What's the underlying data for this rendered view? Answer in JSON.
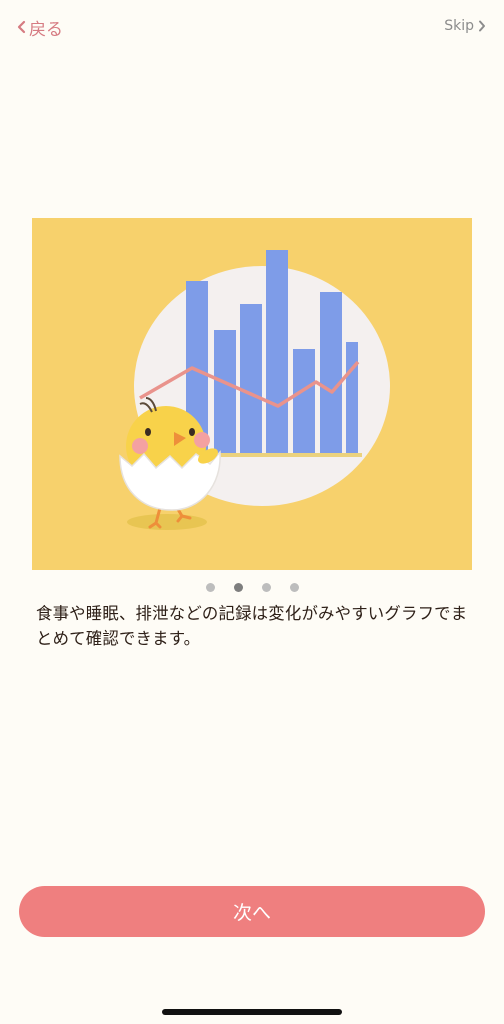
{
  "nav": {
    "back_label": "戻る",
    "skip_label": "Skip"
  },
  "carousel": {
    "page_count": 4,
    "active_index": 1
  },
  "description": "食事や睡眠、排泄などの記録は変化がみやすいグラフでまとめて確認できます。",
  "next_button_label": "次へ",
  "colors": {
    "background": "#FEFCF6",
    "accent": "#EF7F7F",
    "back_text": "#D67B82",
    "hero_bg": "#F7D16C",
    "bar": "#7E9CE8",
    "line": "#E9938C"
  }
}
